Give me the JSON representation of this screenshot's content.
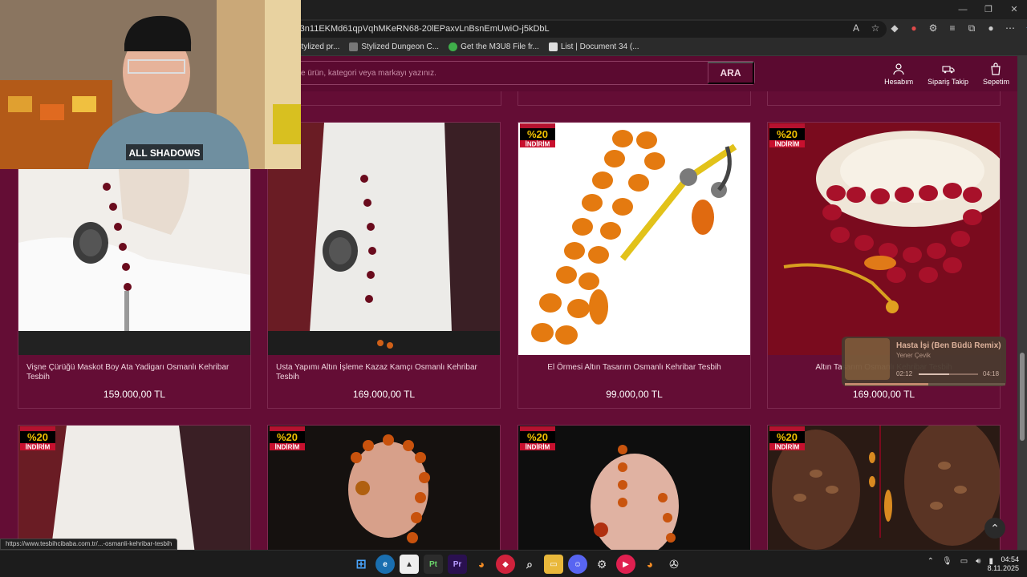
{
  "browser": {
    "url": "r3n11EKMd61qpVqhMKeRN68-20lEPaxvLnBsnEmUwiO-j5kDbL",
    "bookmarks": [
      "al stylized pr...",
      "Stylized Dungeon C...",
      "Get the M3U8 File fr...",
      "List | Document 34 (..."
    ],
    "status_url": "https://www.tesbihciba​ba.com.tr/...-osmanli-kehribar-tesbih"
  },
  "header": {
    "search_placeholder": "e ürün, kategori veya markayı yazınız.",
    "search_button": "ARA",
    "links": [
      "Hesabım",
      "Sipariş Takip",
      "Sepetim"
    ]
  },
  "badge": {
    "top": "2 ve üzeri ürünlerde",
    "num": "%20",
    "word": "İNDİRİM"
  },
  "products": [
    {
      "title": "Vişne Çürüğü Maskot Boy Ata Yadigarı Osmanlı Kehribar Tesbih",
      "price": "159.000,00 TL"
    },
    {
      "title": "Usta Yapımı Altın İşleme Kazaz Kamçı Osmanlı Kehribar Tesbih",
      "price": "169.000,00 TL"
    },
    {
      "title": "El Örmesi Altın Tasarım Osmanlı Kehribar Tesbih",
      "price": "99.000,00 TL"
    },
    {
      "title": "Altın Tasarım Osmanlı Kehribar Tesbih",
      "price": "169.000,00 TL"
    }
  ],
  "music": {
    "title": "Hasta İşi (Ben Büdü Remix)",
    "artist": "Yener Çevik",
    "elapsed": "02:12",
    "total": "04:18",
    "progress": 0.52
  },
  "taskbar": {
    "time": "04:54",
    "date": "8.11.2025"
  },
  "colors": {
    "site_bg": "#640d35",
    "header_bg": "#5b0a30",
    "border": "#7d2a50"
  }
}
